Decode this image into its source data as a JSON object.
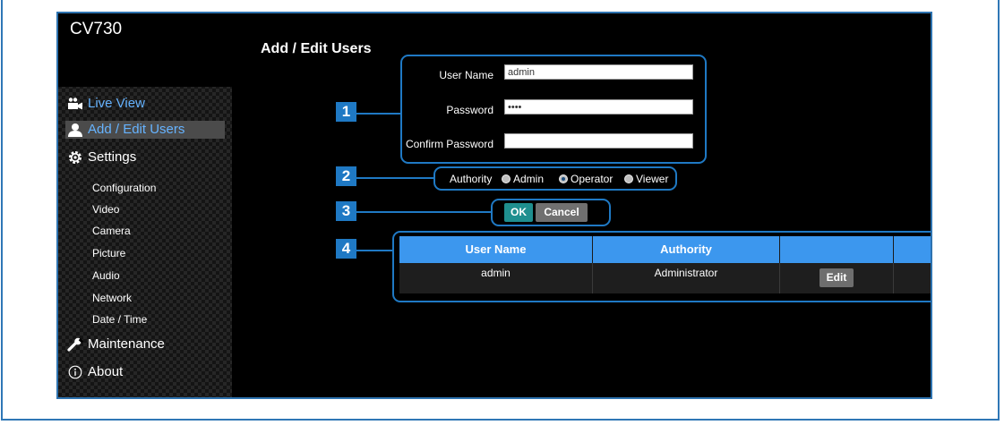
{
  "app": {
    "model": "CV730"
  },
  "sidebar": {
    "main_items": [
      {
        "label": "Live View",
        "icon": "video-camera-icon"
      },
      {
        "label": "Add / Edit Users",
        "icon": "user-icon"
      },
      {
        "label": "Settings",
        "icon": "gear-icon"
      },
      {
        "label": "Maintenance",
        "icon": "wrench-icon"
      },
      {
        "label": "About",
        "icon": "info-icon"
      }
    ],
    "settings_items": [
      "Configuration",
      "Video",
      "Camera",
      "Picture",
      "Audio",
      "Network",
      "Date / Time"
    ]
  },
  "page": {
    "title": "Add / Edit Users"
  },
  "form": {
    "user_name_label": "User Name",
    "user_name_value": "admin",
    "password_label": "Password",
    "password_value": "••••",
    "confirm_label": "Confirm Password",
    "confirm_value": ""
  },
  "authority": {
    "label": "Authority",
    "options": [
      "Admin",
      "Operator",
      "Viewer"
    ],
    "selected": "Operator"
  },
  "buttons": {
    "ok": "OK",
    "cancel": "Cancel",
    "edit": "Edit"
  },
  "table": {
    "headers": [
      "User Name",
      "Authority"
    ],
    "rows": [
      {
        "user_name": "admin",
        "authority": "Administrator"
      }
    ]
  },
  "callouts": [
    "1",
    "2",
    "3",
    "4"
  ],
  "colors": {
    "accent": "#1f79c4",
    "header_blue": "#3c97ee",
    "ok_green": "#1f8f8f",
    "active_nav": "#4b4b4b"
  }
}
